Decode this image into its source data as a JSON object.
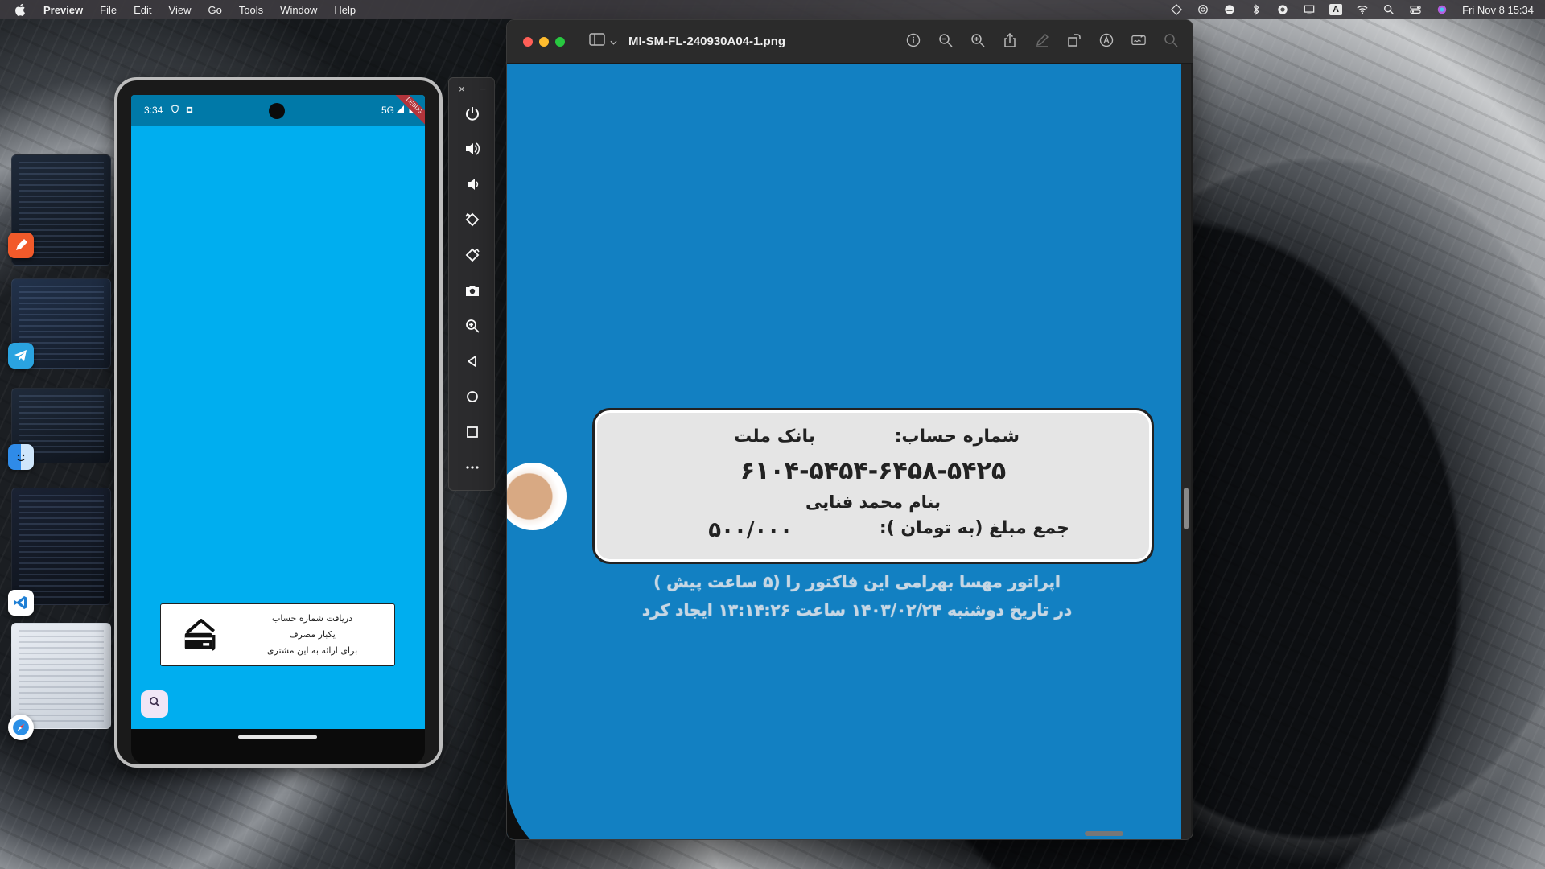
{
  "menubar": {
    "app_name": "Preview",
    "items": [
      "File",
      "Edit",
      "View",
      "Go",
      "Tools",
      "Window",
      "Help"
    ],
    "keyboard_badge": "A",
    "datetime": "Fri Nov 8  15:34"
  },
  "emulator": {
    "status_time": "3:34",
    "status_network": "5G",
    "debug_ribbon": "DEBUG",
    "card": {
      "line1": "دریافت شماره حساب",
      "line2": "یکبار مصرف",
      "line3": "برای ارائه به این مشتری"
    },
    "toolbar": {
      "close": "×",
      "minimize": "−",
      "buttons": [
        "power-icon",
        "volume-up-icon",
        "volume-down-icon",
        "rotate-left-icon",
        "rotate-right-icon",
        "camera-icon",
        "zoom-icon",
        "back-icon",
        "home-icon",
        "overview-icon",
        "more-icon"
      ]
    }
  },
  "preview": {
    "filename": "MI-SM-FL-240930A04-1.png",
    "receipt": {
      "account_label": "شماره حساب:",
      "bank_name": "بانک ملت",
      "account_number": "۶۱۰۴-۵۴۵۴-۶۴۵۸-۵۴۲۵",
      "holder": "بنام محمد فنایی",
      "amount_label": "جمع مبلغ (به تومان ):",
      "amount": "۵۰۰/۰۰۰"
    },
    "note_line1": "اپراتور مهسا بهرامی این فاکتور را  (۵ ساعت پیش )",
    "note_line2": "در تاریخ دوشنبه ۱۴۰۳/۰۲/۲۴ ساعت ۱۳:۱۴:۲۶ ایجاد کرد"
  },
  "colors": {
    "emulator_screen": "#00aeef",
    "emulator_status": "#0079a8",
    "preview_canvas": "#1280c2",
    "receipt_bg": "#e5e5e5"
  }
}
